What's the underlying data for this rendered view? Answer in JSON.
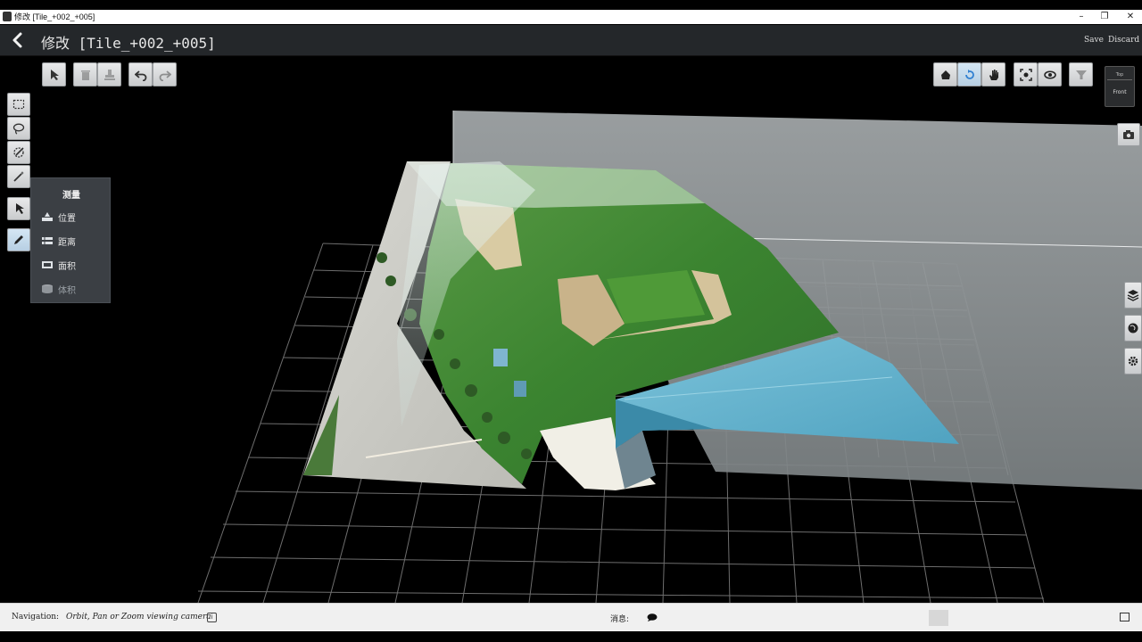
{
  "window": {
    "title": "修改 [Tile_+002_+005]",
    "controls": {
      "minimize": "–",
      "restore": "❐",
      "close": "✕"
    }
  },
  "header": {
    "title": "修改 [Tile_+002_+005]",
    "save_label": "Save",
    "discard_label": "Discard"
  },
  "toolbar_left": [
    "pointer-icon",
    "trash-icon",
    "stamp-icon",
    "undo-icon",
    "redo-icon"
  ],
  "toolbar_right": [
    "home-icon",
    "orbit-icon",
    "pan-hand-icon",
    "fit-view-icon",
    "eye-icon",
    "filter-icon"
  ],
  "viewcube": {
    "top_label": "Top",
    "front_label": "Front"
  },
  "side_tools": [
    "rect-select-icon",
    "lasso-icon",
    "brush-select-icon",
    "magic-wand-icon",
    "classify-icon",
    "measure-pen-icon"
  ],
  "right_panel_icons": [
    "camera-icon",
    "layers-icon",
    "globe-icon",
    "settings-icon"
  ],
  "measure_menu": {
    "title": "测量",
    "items": [
      {
        "label": "位置",
        "icon": "location-icon",
        "enabled": true
      },
      {
        "label": "距离",
        "icon": "distance-icon",
        "enabled": true
      },
      {
        "label": "面积",
        "icon": "area-icon",
        "enabled": true
      },
      {
        "label": "体积",
        "icon": "volume-icon",
        "enabled": false
      }
    ]
  },
  "status": {
    "nav_label": "Navigation:",
    "nav_value": "Orbit, Pan or Zoom viewing camera",
    "info_symbol": "i",
    "message_label": "消息:"
  },
  "colors": {
    "background": "#000000",
    "grid": "#6e6e6e",
    "vegetation": "#3f8a32",
    "roof": "#5fb3cf",
    "road": "#c9c9c4",
    "ground_plane": "#8e9597",
    "accent": "#2f7fd1"
  }
}
